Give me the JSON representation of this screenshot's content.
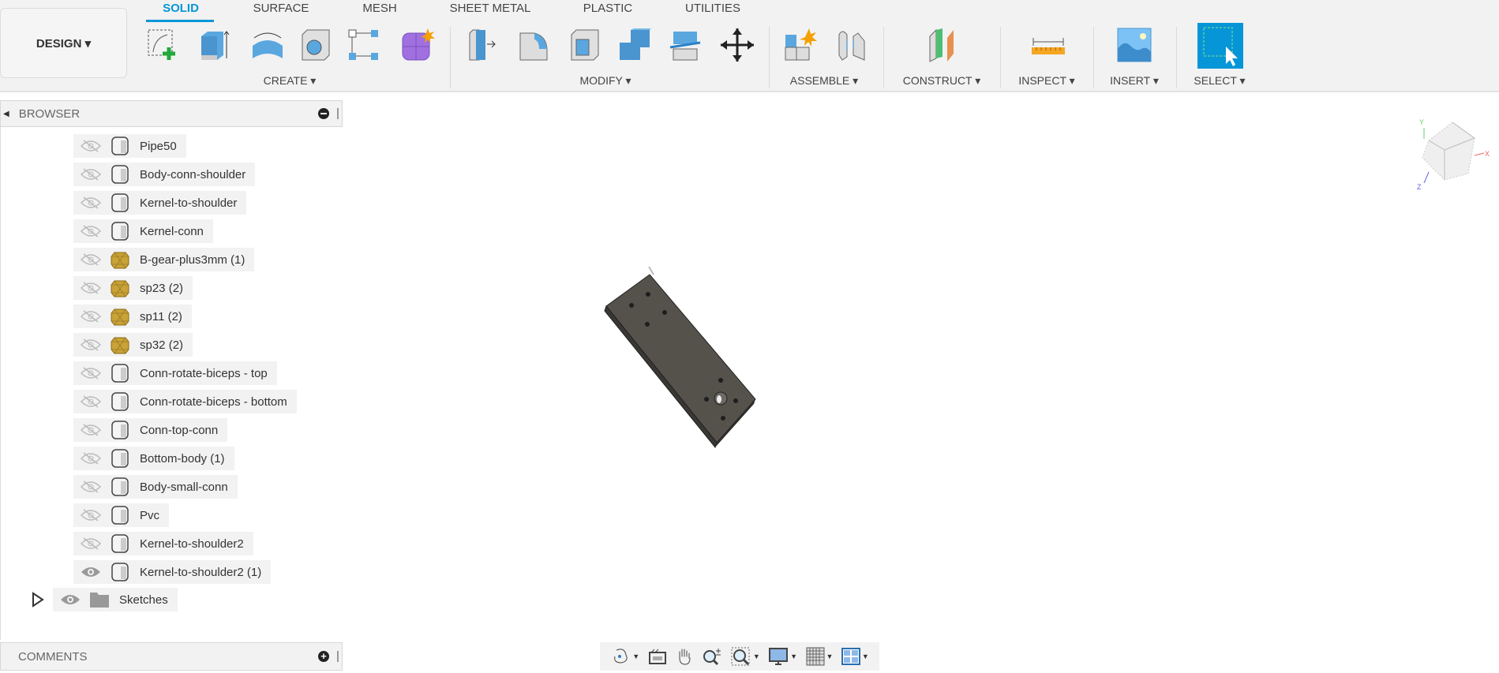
{
  "workspace": {
    "label": "DESIGN ▾"
  },
  "tabs": [
    "SOLID",
    "SURFACE",
    "MESH",
    "SHEET METAL",
    "PLASTIC",
    "UTILITIES"
  ],
  "groups": {
    "create": "CREATE ▾",
    "modify": "MODIFY ▾",
    "assemble": "ASSEMBLE ▾",
    "construct": "CONSTRUCT ▾",
    "inspect": "INSPECT ▾",
    "insert": "INSERT ▾",
    "select": "SELECT ▾"
  },
  "browser": {
    "title": "BROWSER",
    "items": [
      {
        "label": "Pipe50",
        "visible": false,
        "type": "body"
      },
      {
        "label": "Body-conn-shoulder",
        "visible": false,
        "type": "body"
      },
      {
        "label": "Kernel-to-shoulder",
        "visible": false,
        "type": "body"
      },
      {
        "label": "Kernel-conn",
        "visible": false,
        "type": "body"
      },
      {
        "label": "B-gear-plus3mm (1)",
        "visible": false,
        "type": "component"
      },
      {
        "label": "sp23 (2)",
        "visible": false,
        "type": "component"
      },
      {
        "label": "sp11 (2)",
        "visible": false,
        "type": "component"
      },
      {
        "label": "sp32 (2)",
        "visible": false,
        "type": "component"
      },
      {
        "label": "Conn-rotate-biceps  - top",
        "visible": false,
        "type": "body"
      },
      {
        "label": "Conn-rotate-biceps - bottom",
        "visible": false,
        "type": "body"
      },
      {
        "label": "Conn-top-conn",
        "visible": false,
        "type": "body"
      },
      {
        "label": "Bottom-body (1)",
        "visible": false,
        "type": "body"
      },
      {
        "label": "Body-small-conn",
        "visible": false,
        "type": "body"
      },
      {
        "label": "Pvc",
        "visible": false,
        "type": "body"
      },
      {
        "label": "Kernel-to-shoulder2",
        "visible": false,
        "type": "body"
      },
      {
        "label": "Kernel-to-shoulder2 (1)",
        "visible": true,
        "type": "body"
      }
    ],
    "folder": {
      "label": "Sketches"
    }
  },
  "comments": {
    "title": "COMMENTS"
  },
  "viewcube": {
    "axes": [
      "X",
      "Y",
      "Z"
    ]
  },
  "colors": {
    "accent": "#0696d7",
    "toolbar_bg": "#f2f2f2",
    "part": "#4a4843"
  }
}
